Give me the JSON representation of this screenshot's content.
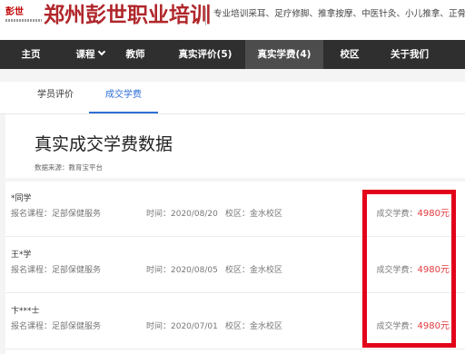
{
  "header": {
    "logo_text": "彭世",
    "brand_title": "郑州彭世职业培训",
    "tagline": "专业培训采耳、足疗修脚、推拿按摩、中医针灸、小儿推拿、正骨"
  },
  "nav": {
    "items": [
      {
        "label": "主页"
      },
      {
        "label": "课程"
      },
      {
        "label": "教师"
      },
      {
        "label": "真实评价(5)"
      },
      {
        "label": "真实学费(4)"
      },
      {
        "label": "校区"
      },
      {
        "label": "关于我们"
      }
    ],
    "active_index": 4
  },
  "tabs": {
    "items": [
      {
        "label": "学员评价"
      },
      {
        "label": "成交学费"
      }
    ],
    "active_index": 1
  },
  "main": {
    "title": "真实成交学费数据",
    "data_source": "数据来源：教育宝平台"
  },
  "records": [
    {
      "name": "*同学",
      "course": "报名课程：足部保健服务",
      "time": "时间：2020/08/20",
      "campus": "校区：金水校区",
      "fee_label": "成交学费：",
      "fee_amount": "4980元"
    },
    {
      "name": "王*学",
      "course": "报名课程：足部保健服务",
      "time": "时间：2020/08/05",
      "campus": "校区：金水校区",
      "fee_label": "成交学费：",
      "fee_amount": "4980元"
    },
    {
      "name": "卞***士",
      "course": "报名课程：足部保健服务",
      "time": "时间：2020/07/01",
      "campus": "校区：金水校区",
      "fee_label": "成交学费：",
      "fee_amount": "4980元"
    }
  ],
  "colors": {
    "brand": "#b0272b",
    "nav_bg": "#2f2f2f",
    "nav_active_bg": "#4d4d4d",
    "tab_active": "#2f6fd6",
    "fee_amount": "#e4393c",
    "highlight_box": "#e2001a"
  }
}
